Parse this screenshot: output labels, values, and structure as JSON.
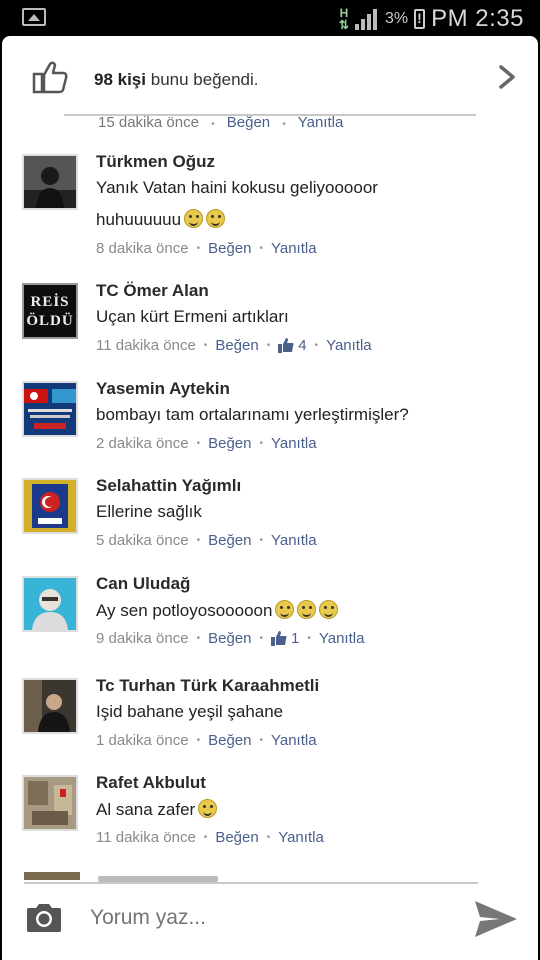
{
  "status_bar": {
    "network": "H",
    "battery_percent": "3%",
    "time": "PM 2:35"
  },
  "likes": {
    "count": "98 kişi",
    "suffix": "bunu beğendi."
  },
  "partial_comment": {
    "time": "15 dakika önce",
    "like": "Beğen",
    "reply": "Yanıtla"
  },
  "comments": [
    {
      "name": "Türkmen Oğuz",
      "line1": "Yanık Vatan haini kokusu geliyooooor",
      "line2": "huhuuuuuu",
      "time": "8 dakika önce",
      "like": "Beğen",
      "likes_count": "",
      "reply": "Yanıtla"
    },
    {
      "name": "TC Ömer Alan",
      "line1": "Uçan kürt Ermeni artıkları",
      "avatar_text": "REİS ÖLDÜ",
      "time": "11 dakika önce",
      "like": "Beğen",
      "likes_count": "4",
      "reply": "Yanıtla"
    },
    {
      "name": "Yasemin Aytekin",
      "line1": "bombayı tam ortalarınamı yerleştirmişler?",
      "time": "2 dakika önce",
      "like": "Beğen",
      "likes_count": "",
      "reply": "Yanıtla"
    },
    {
      "name": "Selahattin Yağımlı",
      "line1": "Ellerine sağlık",
      "time": "5 dakika önce",
      "like": "Beğen",
      "likes_count": "",
      "reply": "Yanıtla"
    },
    {
      "name": "Can Uludağ",
      "line1": "Ay sen potloyosooooon",
      "time": "9 dakika önce",
      "like": "Beğen",
      "likes_count": "1",
      "reply": "Yanıtla"
    },
    {
      "name": "Tc Turhan Türk Karaahmetli",
      "line1": "Işid bahane yeşil şahane",
      "time": "1 dakika önce",
      "like": "Beğen",
      "likes_count": "",
      "reply": "Yanıtla"
    },
    {
      "name": "Rafet Akbulut",
      "line1": "Al sana zafer",
      "time": "11 dakika önce",
      "like": "Beğen",
      "likes_count": "",
      "reply": "Yanıtla"
    }
  ],
  "composer": {
    "placeholder": "Yorum yaz..."
  },
  "icons": {
    "like": "thumbs-up-icon",
    "chevron": "chevron-right-icon",
    "camera": "camera-icon",
    "send": "send-icon"
  }
}
